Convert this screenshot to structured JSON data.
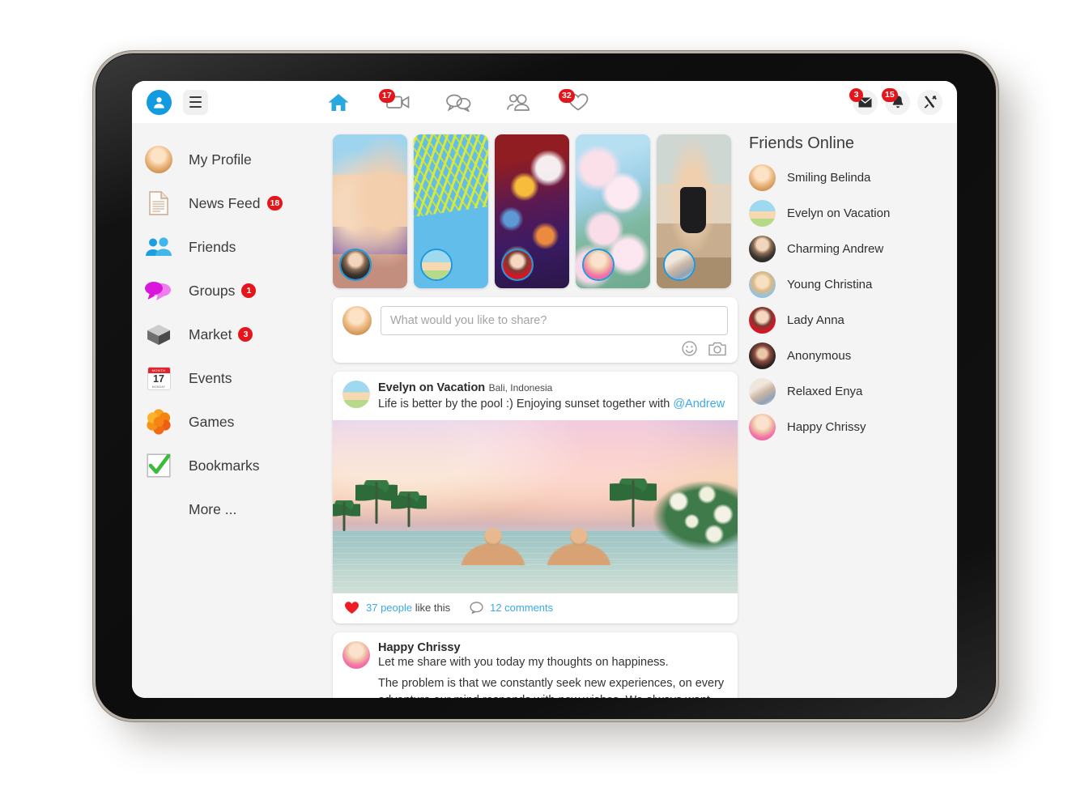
{
  "app": {
    "brand_color": "#129bdf",
    "badge_color": "#e4151b",
    "link_color": "#3ba9e8"
  },
  "topbar": {
    "profile_icon": "user-avatar-icon",
    "menu_icon": "hamburger-menu-icon",
    "nav": [
      {
        "name": "home",
        "icon": "home-icon",
        "badge": "",
        "active": true
      },
      {
        "name": "videos",
        "icon": "video-camera-icon",
        "badge": "17",
        "active": false
      },
      {
        "name": "messages",
        "icon": "chat-bubbles-icon",
        "badge": "",
        "active": false
      },
      {
        "name": "people",
        "icon": "people-icon",
        "badge": "",
        "active": false
      },
      {
        "name": "likes",
        "icon": "heart-icon",
        "badge": "32",
        "active": false
      }
    ],
    "actions": [
      {
        "name": "inbox",
        "icon": "envelope-icon",
        "badge": "3"
      },
      {
        "name": "notifications",
        "icon": "bell-icon",
        "badge": "15"
      },
      {
        "name": "settings",
        "icon": "tools-icon",
        "badge": ""
      }
    ]
  },
  "sidebar": {
    "items": [
      {
        "label": "My Profile",
        "icon": "profile-photo-icon",
        "badge": ""
      },
      {
        "label": "News Feed",
        "icon": "document-icon",
        "badge": "18"
      },
      {
        "label": "Friends",
        "icon": "friends-icon",
        "badge": ""
      },
      {
        "label": "Groups",
        "icon": "speech-bubbles-icon",
        "badge": "1"
      },
      {
        "label": "Market",
        "icon": "box-icon",
        "badge": "3"
      },
      {
        "label": "Events",
        "icon": "calendar-icon",
        "badge": ""
      },
      {
        "label": "Games",
        "icon": "games-flower-icon",
        "badge": ""
      },
      {
        "label": "Bookmarks",
        "icon": "checkmark-icon",
        "badge": ""
      },
      {
        "label": "More ...",
        "icon": "",
        "badge": ""
      }
    ],
    "calendar": {
      "month": "MONTH",
      "day": "17",
      "weekday": "MONDAY"
    }
  },
  "stories": [
    {
      "name": "couple-selfie-story",
      "owner_avatar": "charming-andrew-avatar"
    },
    {
      "name": "palm-leaf-story",
      "owner_avatar": "evelyn-on-vacation-avatar"
    },
    {
      "name": "bokeh-lights-story",
      "owner_avatar": "lady-anna-avatar"
    },
    {
      "name": "cherry-blossom-story",
      "owner_avatar": "happy-chrissy-avatar"
    },
    {
      "name": "fitness-woman-story",
      "owner_avatar": "relaxed-enya-avatar"
    }
  ],
  "composer": {
    "placeholder": "What would you like to share?",
    "value": "",
    "emoji_icon": "smiley-icon",
    "photo_icon": "camera-icon"
  },
  "posts": [
    {
      "author": "Evelyn on Vacation",
      "location": "Bali, Indonesia",
      "text_before_mention": "Life is better by the pool :) Enjoying sunset together with ",
      "mention": "@Andrew",
      "photo": "sunset-infinity-pool-photo",
      "likes_count": "37 people",
      "likes_suffix": "like this",
      "comments": "12 comments",
      "like_icon": "heart-icon",
      "comment_icon": "comment-bubble-icon"
    },
    {
      "author": "Happy Chrissy",
      "line1": "Let me share with you today my thoughts on happiness.",
      "line2": "The problem is that we constantly seek new experiences, on every adventure our mind responds with new wishes. We always want something more and better. But happiness lies in not needing more"
    }
  ],
  "friends_online": {
    "title": "Friends Online",
    "items": [
      {
        "name": "Smiling Belinda",
        "avatar": "smiling-belinda-avatar"
      },
      {
        "name": "Evelyn on Vacation",
        "avatar": "evelyn-on-vacation-avatar"
      },
      {
        "name": "Charming Andrew",
        "avatar": "charming-andrew-avatar"
      },
      {
        "name": "Young Christina",
        "avatar": "young-christina-avatar"
      },
      {
        "name": "Lady Anna",
        "avatar": "lady-anna-avatar"
      },
      {
        "name": "Anonymous",
        "avatar": "anonymous-avatar"
      },
      {
        "name": "Relaxed Enya",
        "avatar": "relaxed-enya-avatar"
      },
      {
        "name": "Happy Chrissy",
        "avatar": "happy-chrissy-avatar"
      }
    ]
  }
}
